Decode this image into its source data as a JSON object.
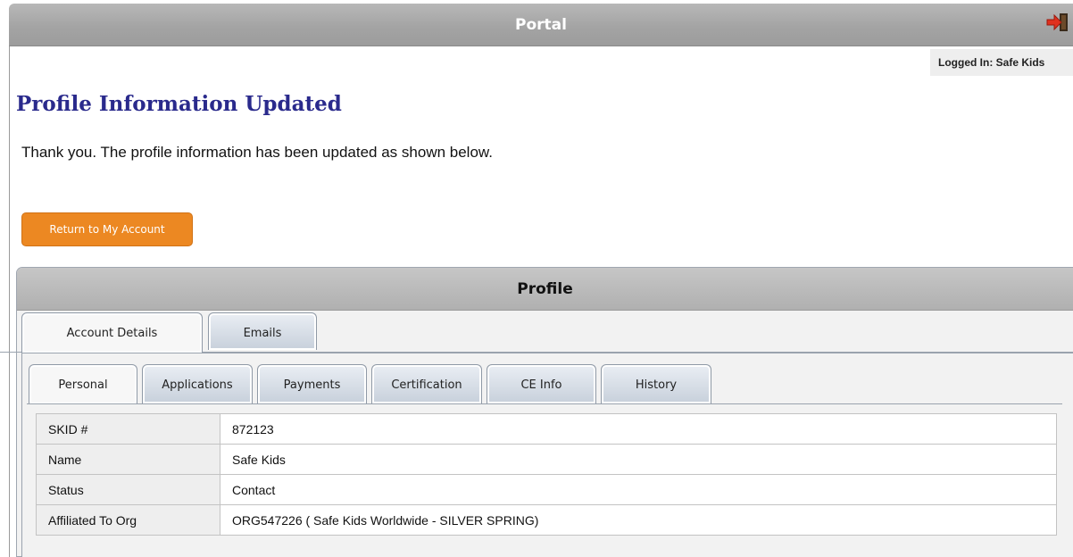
{
  "header": {
    "title": "Portal",
    "logout_icon": "logout-icon",
    "logged_in": "Logged In: Safe Kids"
  },
  "page": {
    "title": "Profile Information Updated",
    "message": "Thank you. The profile information has been updated as shown below.",
    "return_button": "Return to My Account"
  },
  "panel": {
    "title": "Profile",
    "outer_tabs": [
      {
        "label": "Account Details",
        "active": true
      },
      {
        "label": "Emails",
        "active": false
      }
    ],
    "inner_tabs": [
      {
        "label": "Personal",
        "active": true
      },
      {
        "label": "Applications",
        "active": false
      },
      {
        "label": "Payments",
        "active": false
      },
      {
        "label": "Certification",
        "active": false
      },
      {
        "label": "CE Info",
        "active": false
      },
      {
        "label": "History",
        "active": false
      }
    ],
    "rows": [
      {
        "label": "SKID #",
        "value": "872123"
      },
      {
        "label": "Name",
        "value": "Safe Kids"
      },
      {
        "label": "Status",
        "value": "Contact"
      },
      {
        "label": "Affiliated To Org",
        "value": "ORG547226 ( Safe Kids Worldwide - SILVER SPRING)"
      }
    ]
  },
  "colors": {
    "accent_button": "#ec8822",
    "title_color": "#2a2a8c",
    "header_gray": "#a4a4a4"
  }
}
